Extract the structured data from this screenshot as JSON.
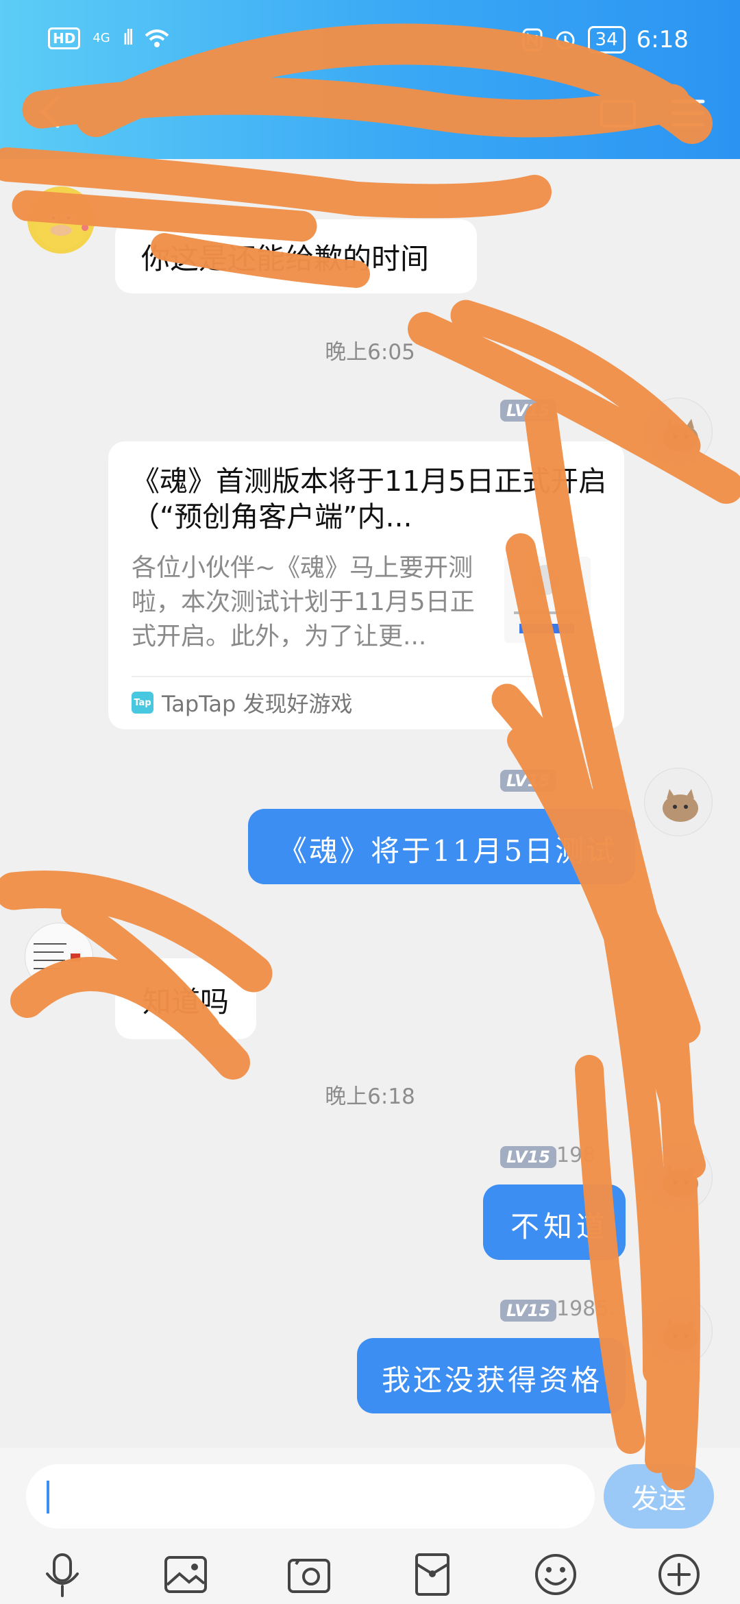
{
  "status_bar": {
    "hd": "HD",
    "network": "4G",
    "signal": "ıll",
    "battery": "34",
    "time": "6:18"
  },
  "messages": [
    {
      "text": "你这是还能给歉的时间"
    },
    {
      "timestamp": "晚上6:05"
    },
    {
      "level": "LV15",
      "card": {
        "title": "《魂》首测版本将于11月5日正式开启（“预创角客户端”内...",
        "desc": "各位小伙伴~《魂》马上要开测啦，本次测试计划于11月5日正式开启。此外，为了让更...",
        "source_logo": "Tap",
        "source": "TapTap 发现好游戏"
      }
    },
    {
      "level": "LV15",
      "text": "《魂》将于11月5日测试"
    },
    {
      "text": "知道吗"
    },
    {
      "timestamp": "晚上6:18"
    },
    {
      "level": "LV15",
      "username": "198",
      "text": "不知道"
    },
    {
      "level": "LV15",
      "username": "1985.",
      "text": "我还没获得资格"
    }
  ],
  "input": {
    "value": "",
    "send_label": "发送"
  },
  "toolbar": [
    "microphone-icon",
    "image-icon",
    "camera-icon",
    "red-packet-icon",
    "emoji-icon",
    "plus-icon"
  ],
  "colors": {
    "header_start": "#5ccdf6",
    "header_end": "#2b94f2",
    "outgoing_bubble": "#3d8ef2",
    "send_button": "#9ac8f7",
    "scribble": "#f0904a"
  }
}
